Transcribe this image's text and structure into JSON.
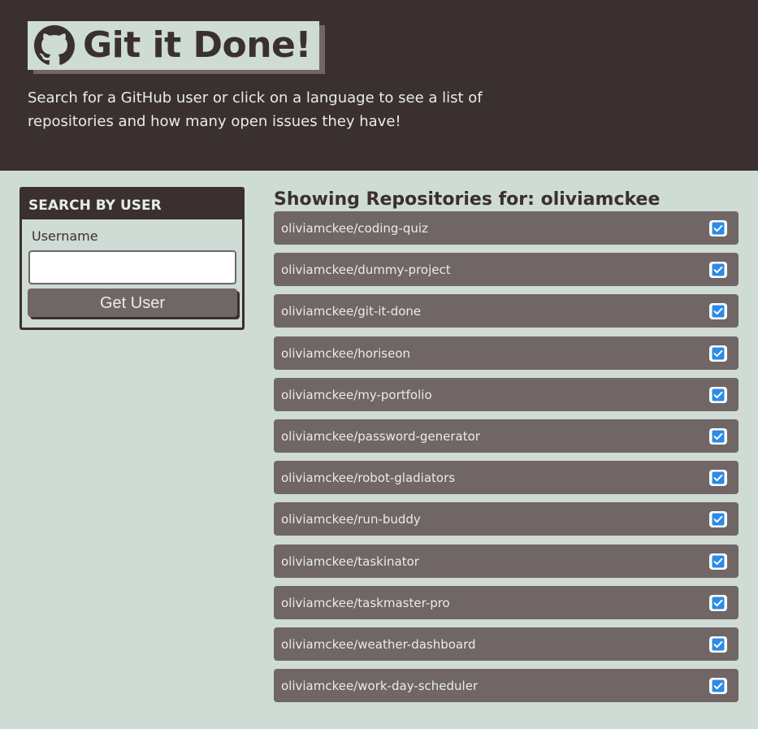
{
  "header": {
    "title": "Git it Done!",
    "subtitle": "Search for a GitHub user or click on a language to see a list of repositories and how many open issues they have!",
    "logo_icon": "github-icon"
  },
  "search": {
    "heading": "Search by User",
    "username_label": "Username",
    "username_value": "",
    "button_label": "Get User"
  },
  "repos": {
    "heading": "Showing Repositories for: oliviamckee",
    "check_icon": "checkbox-checked-icon",
    "check_color": "#2b8be6",
    "items": [
      {
        "name": "oliviamckee/coding-quiz"
      },
      {
        "name": "oliviamckee/dummy-project"
      },
      {
        "name": "oliviamckee/git-it-done"
      },
      {
        "name": "oliviamckee/horiseon"
      },
      {
        "name": "oliviamckee/my-portfolio"
      },
      {
        "name": "oliviamckee/password-generator"
      },
      {
        "name": "oliviamckee/robot-gladiators"
      },
      {
        "name": "oliviamckee/run-buddy"
      },
      {
        "name": "oliviamckee/taskinator"
      },
      {
        "name": "oliviamckee/taskmaster-pro"
      },
      {
        "name": "oliviamckee/weather-dashboard"
      },
      {
        "name": "oliviamckee/work-day-scheduler"
      }
    ]
  },
  "colors": {
    "dark": "#3a3030",
    "muted": "#706665",
    "background": "#cfdbd5",
    "light_text": "#e7ecea"
  }
}
